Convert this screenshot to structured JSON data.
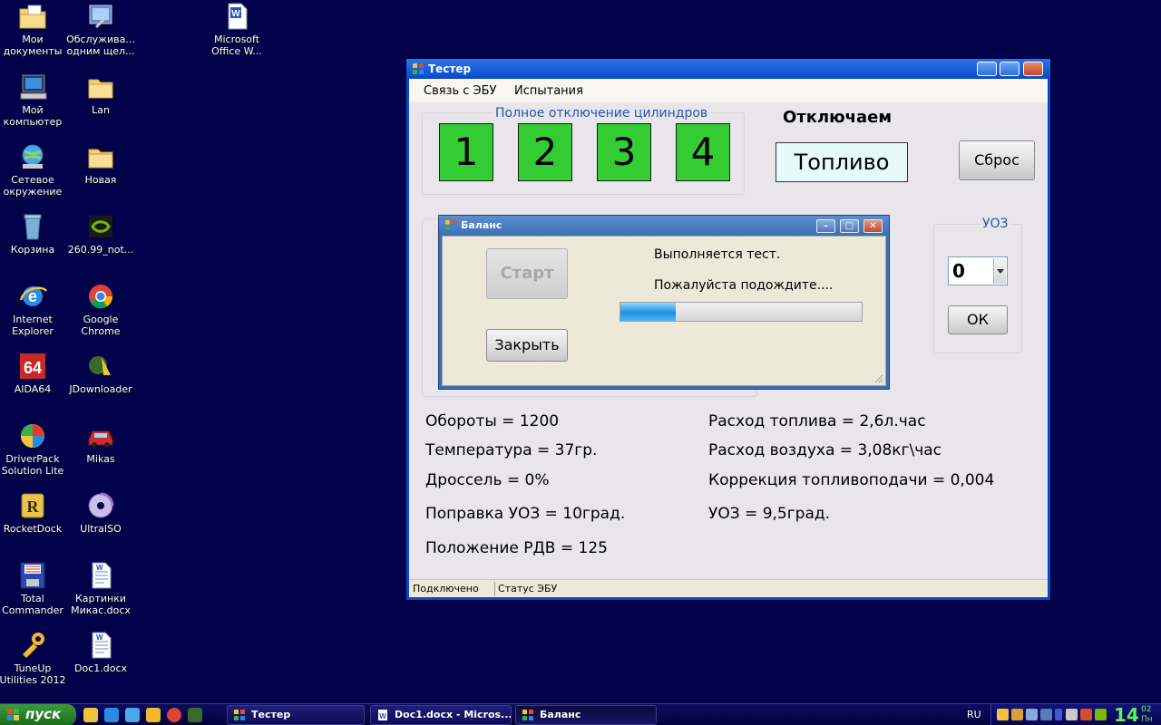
{
  "desktop": {
    "icons": [
      {
        "label": "Мои документы",
        "icon": "folder-documents-icon"
      },
      {
        "label": "Обслужива... одним щел...",
        "icon": "maintenance-shortcut-icon"
      },
      {
        "label": "Microsoft Office W...",
        "icon": "word-shortcut-icon"
      },
      {
        "label": "Мой компьютер",
        "icon": "my-computer-icon"
      },
      {
        "label": "Lan",
        "icon": "folder-icon"
      },
      {
        "label": "Сетевое окружение",
        "icon": "network-icon"
      },
      {
        "label": "Новая",
        "icon": "folder-icon"
      },
      {
        "label": "Корзина",
        "icon": "recycle-bin-icon"
      },
      {
        "label": "260.99_not...",
        "icon": "nvidia-icon"
      },
      {
        "label": "Internet Explorer",
        "icon": "internet-explorer-icon"
      },
      {
        "label": "Google Chrome",
        "icon": "chrome-icon"
      },
      {
        "label": "AIDA64",
        "icon": "aida64-icon"
      },
      {
        "label": "JDownloader",
        "icon": "jdownloader-icon"
      },
      {
        "label": "DriverPack Solution Lite",
        "icon": "driverpack-icon"
      },
      {
        "label": "Mikas",
        "icon": "car-icon"
      },
      {
        "label": "RocketDock",
        "icon": "rocketdock-icon"
      },
      {
        "label": "UltraISO",
        "icon": "ultraiso-disc-icon"
      },
      {
        "label": "Total Commander",
        "icon": "floppy-icon"
      },
      {
        "label": "Картинки Микас.docx",
        "icon": "word-document-icon"
      },
      {
        "label": "TuneUp Utilities 2012",
        "icon": "tuneup-icon"
      },
      {
        "label": "Doc1.docx",
        "icon": "word-document-icon"
      }
    ]
  },
  "main_window": {
    "title": "Тестер",
    "menu": [
      "Связь с ЭБУ",
      "Испытания"
    ],
    "cylinder_group_title": "Полное отключение цилиндров",
    "cylinders": [
      "1",
      "2",
      "3",
      "4"
    ],
    "disable_label": "Отключаем",
    "fuel_value": "Топливо",
    "reset_button": "Сброс",
    "uoz_group_title": "УОЗ",
    "uoz_combo_value": "0",
    "ok_button": "ОК",
    "params_left": [
      "Обороты = 1200",
      "Температура = 37гр.",
      "Дроссель = 0%",
      "Поправка УОЗ = 10град.",
      "Положение РДВ = 125"
    ],
    "params_right": [
      "Расход топлива = 2,6л.час",
      "Расход воздуха = 3,08кг\\час",
      "Коррекция топливоподачи = 0,004",
      "УОЗ = 9,5град."
    ],
    "status_connected": "Подключено",
    "status_ecu": "Статус ЭБУ"
  },
  "dialog": {
    "title": "Баланс",
    "start_button": "Старт",
    "close_button": "Закрыть",
    "message_1": "Выполняется тест.",
    "message_2": "Пожалуйста подождите....",
    "progress_fraction": 0.23
  },
  "taskbar": {
    "start_label": "пуск",
    "tasks": [
      {
        "label": "Тестер",
        "active": false
      },
      {
        "label": "Doc1.docx - Micros...",
        "active": false
      },
      {
        "label": "Баланс",
        "active": true
      }
    ],
    "language": "RU",
    "clock_hour": "14",
    "clock_minute": "02",
    "clock_day": "Пн"
  }
}
